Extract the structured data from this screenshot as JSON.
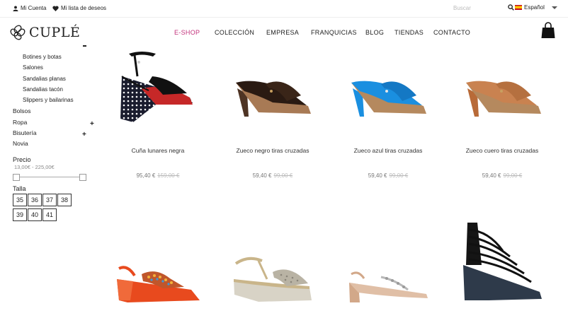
{
  "topbar": {
    "account_label": "Mi Cuenta",
    "wishlist_label": "Mi lista de deseos",
    "search_placeholder": "Buscar",
    "language_label": "Español"
  },
  "brand": {
    "name": "CUPLÉ"
  },
  "nav": [
    "E-SHOP",
    "COLECCIÓN",
    "EMPRESA",
    "FRANQUICIAS",
    "BLOG",
    "TIENDAS",
    "CONTACTO"
  ],
  "sidebar": {
    "subcategories": [
      "Botines y botas",
      "Salones",
      "Sandalias planas",
      "Sandalias tacón",
      "Slippers y bailarinas"
    ],
    "categories": [
      "Bolsos",
      "Ropa",
      "Bisutería",
      "Novia"
    ],
    "price_title": "Precio",
    "price_range": "13,00€ - 225,00€",
    "size_title": "Talla",
    "sizes": [
      "35",
      "36",
      "37",
      "38",
      "39",
      "40",
      "41"
    ]
  },
  "products": [
    {
      "name": "Cuña lunares negra",
      "price": "95,40 €",
      "old_price": "159,00 €"
    },
    {
      "name": "Zueco negro tiras cruzadas",
      "price": "59,40 €",
      "old_price": "99,00 €"
    },
    {
      "name": "Zueco azul tiras cruzadas",
      "price": "59,40 €",
      "old_price": "99,00 €"
    },
    {
      "name": "Zueco cuero tiras cruzadas",
      "price": "59,40 €",
      "old_price": "99,00 €"
    }
  ],
  "colors": {
    "accent": "#c2317b",
    "blue": "#1a8fe0",
    "brown": "#c98250",
    "dark": "#2a1a12"
  },
  "icons": [
    "user-icon",
    "heart-icon",
    "search-icon",
    "spain-flag-icon",
    "caret-down-icon",
    "shopping-bag-icon",
    "logo-icon"
  ]
}
